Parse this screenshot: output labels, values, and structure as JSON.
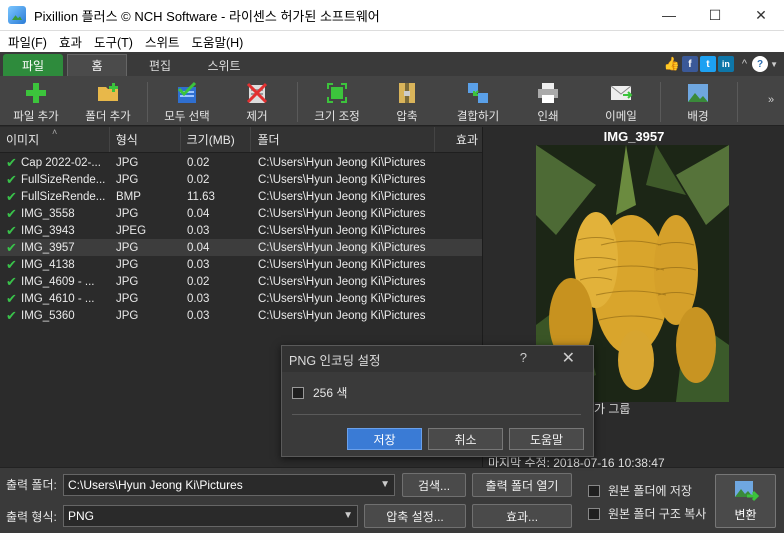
{
  "window": {
    "title": "Pixillion 플러스 © NCH Software - 라이센스 허가된 소프트웨어",
    "minimize": "—",
    "maximize": "☐",
    "close": "✕"
  },
  "menu": [
    "파일(F)",
    "효과",
    "도구(T)",
    "스위트",
    "도움말(H)"
  ],
  "tabs": {
    "file": "파일",
    "home": "홈",
    "edit": "편집",
    "suite": "스위트"
  },
  "social": {
    "like": "👍",
    "facebook": "f",
    "twitter": "t",
    "linkedin": "in",
    "help": "?",
    "collapse": "^"
  },
  "toolbar": {
    "add_file": "파일 추가",
    "add_folder": "폴더 추가",
    "select_all": "모두 선택",
    "remove": "제거",
    "resize": "크기 조정",
    "compress": "압축",
    "combine": "결합하기",
    "print": "인쇄",
    "email": "이메일",
    "background": "배경",
    "more": "»"
  },
  "list": {
    "columns": [
      "이미지",
      "형식",
      "크기(MB)",
      "폴더",
      "효과"
    ],
    "rows": [
      {
        "name": "Cap 2022-02-...",
        "format": "JPG",
        "size": "0.02",
        "folder": "C:\\Users\\Hyun Jeong Ki\\Pictures"
      },
      {
        "name": "FullSizeRende...",
        "format": "JPG",
        "size": "0.02",
        "folder": "C:\\Users\\Hyun Jeong Ki\\Pictures"
      },
      {
        "name": "FullSizeRende...",
        "format": "BMP",
        "size": "11.63",
        "folder": "C:\\Users\\Hyun Jeong Ki\\Pictures"
      },
      {
        "name": "IMG_3558",
        "format": "JPG",
        "size": "0.04",
        "folder": "C:\\Users\\Hyun Jeong Ki\\Pictures"
      },
      {
        "name": "IMG_3943",
        "format": "JPEG",
        "size": "0.03",
        "folder": "C:\\Users\\Hyun Jeong Ki\\Pictures"
      },
      {
        "name": "IMG_3957",
        "format": "JPG",
        "size": "0.04",
        "folder": "C:\\Users\\Hyun Jeong Ki\\Pictures"
      },
      {
        "name": "IMG_4138",
        "format": "JPG",
        "size": "0.03",
        "folder": "C:\\Users\\Hyun Jeong Ki\\Pictures"
      },
      {
        "name": "IMG_4609 - ...",
        "format": "JPG",
        "size": "0.02",
        "folder": "C:\\Users\\Hyun Jeong Ki\\Pictures"
      },
      {
        "name": "IMG_4610 - ...",
        "format": "JPG",
        "size": "0.03",
        "folder": "C:\\Users\\Hyun Jeong Ki\\Pictures"
      },
      {
        "name": "IMG_5360",
        "format": "JPG",
        "size": "0.03",
        "folder": "C:\\Users\\Hyun Jeong Ki\\Pictures"
      }
    ],
    "selected_index": 5
  },
  "preview": {
    "title": "IMG_3957",
    "caption_partial": "가 그룹",
    "date_partial": "마지막 수정: 2018-07-16 10:38:47"
  },
  "bottom": {
    "output_folder_label": "출력 폴더:",
    "output_folder_value": "C:\\Users\\Hyun Jeong Ki\\Pictures",
    "browse": "검색...",
    "open_output": "출력 폴더 열기",
    "output_format_label": "출력 형식:",
    "output_format_value": "PNG",
    "compression": "압축 설정...",
    "effects": "효과...",
    "save_in_source": "원본 폴더에 저장",
    "copy_structure": "원본 폴더 구조 복사",
    "convert": "변환"
  },
  "dialog": {
    "title": "PNG 인코딩 설정",
    "help": "?",
    "close": "✕",
    "option_256": "256 색",
    "ok": "저장",
    "cancel": "취소",
    "help_btn": "도움말"
  }
}
